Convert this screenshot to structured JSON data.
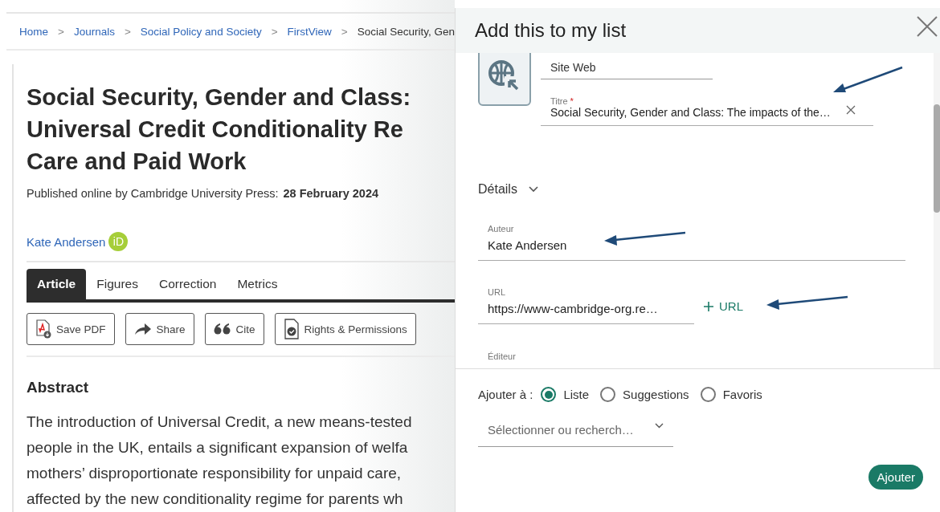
{
  "breadcrumb": [
    {
      "label": "Home",
      "link": true
    },
    {
      "label": "Journals",
      "link": true
    },
    {
      "label": "Social Policy and Society",
      "link": true
    },
    {
      "label": "FirstView",
      "link": true
    },
    {
      "label": "Social Security, Gen",
      "link": false
    }
  ],
  "breadcrumb_separator": ">",
  "article": {
    "title_lines": [
      "Social Security, Gender and Class:",
      "Universal Credit Conditionality Re",
      "Care and Paid Work"
    ],
    "published_label": "Published online by Cambridge University Press:",
    "published_date": "28 February 2024",
    "author": "Kate Andersen",
    "orcid_badge": "iD",
    "tabs": [
      {
        "label": "Article",
        "selected": true
      },
      {
        "label": "Figures",
        "selected": false
      },
      {
        "label": "Correction",
        "selected": false
      },
      {
        "label": "Metrics",
        "selected": false
      }
    ],
    "actions": [
      {
        "label": "Save PDF",
        "kind": "pdf"
      },
      {
        "label": "Share",
        "kind": "share"
      },
      {
        "label": "Cite",
        "kind": "quote"
      },
      {
        "label": "Rights & Permissions",
        "kind": "rights"
      }
    ],
    "abstract_heading": "Abstract",
    "abstract_lines": [
      "The introduction of Universal Credit, a new means-tested",
      "people in the UK, entails a significant expansion of welfa",
      "mothers’ disproportionate responsibility for unpaid care,",
      "affected by the new conditionality regime for parents wh"
    ]
  },
  "dialog": {
    "title": "Add this to my list",
    "type_value": "Site Web",
    "title_field": {
      "label": "Titre",
      "required": true,
      "required_mark": "*",
      "value": "Social Security, Gender and Class: The impacts of the…"
    },
    "details_label": "Détails",
    "author_field": {
      "label": "Auteur",
      "value": "Kate Andersen"
    },
    "url_field": {
      "label": "URL",
      "value": "https://www-cambridge-org.re…",
      "add_label": "URL"
    },
    "publisher_label": "Éditeur",
    "add_to": {
      "label": "Ajouter à :",
      "options": [
        {
          "label": "Liste",
          "selected": true
        },
        {
          "label": "Suggestions",
          "selected": false
        },
        {
          "label": "Favoris",
          "selected": false
        }
      ]
    },
    "list_select": {
      "placeholder": "Sélectionner ou recherch…"
    },
    "submit": "Ajouter"
  }
}
